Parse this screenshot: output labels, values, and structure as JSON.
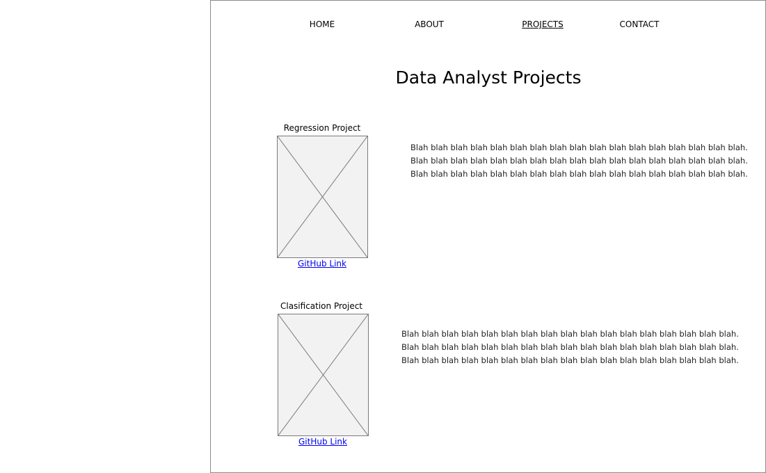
{
  "nav": {
    "items": [
      {
        "label": "HOME"
      },
      {
        "label": "ABOUT"
      },
      {
        "label": "PROJECTS"
      },
      {
        "label": "CONTACT"
      }
    ],
    "active": "PROJECTS"
  },
  "page_title": "Data Analyst Projects",
  "projects": [
    {
      "title": "Regression Project",
      "image": "image-placeholder-icon",
      "link_label": "GitHub Link",
      "description_lines": [
        "Blah blah blah blah blah blah blah blah blah blah blah blah blah blah blah blah blah.",
        "Blah blah blah blah blah blah blah blah blah blah blah blah blah blah blah blah blah.",
        "Blah blah blah blah blah blah blah blah blah blah blah blah blah blah blah blah blah."
      ]
    },
    {
      "title": "Clasification Project",
      "image": "image-placeholder-icon",
      "link_label": "GitHub Link",
      "description_lines": [
        "Blah blah blah blah blah blah blah blah blah blah blah blah blah blah blah blah blah.",
        "Blah blah blah blah blah blah blah blah blah blah blah blah blah blah blah blah blah.",
        "Blah blah blah blah blah blah blah blah blah blah blah blah blah blah blah blah blah."
      ]
    }
  ],
  "colors": {
    "link": "#0000ee",
    "placeholder_fill": "#f2f2f2",
    "border": "#8a8a8a"
  }
}
